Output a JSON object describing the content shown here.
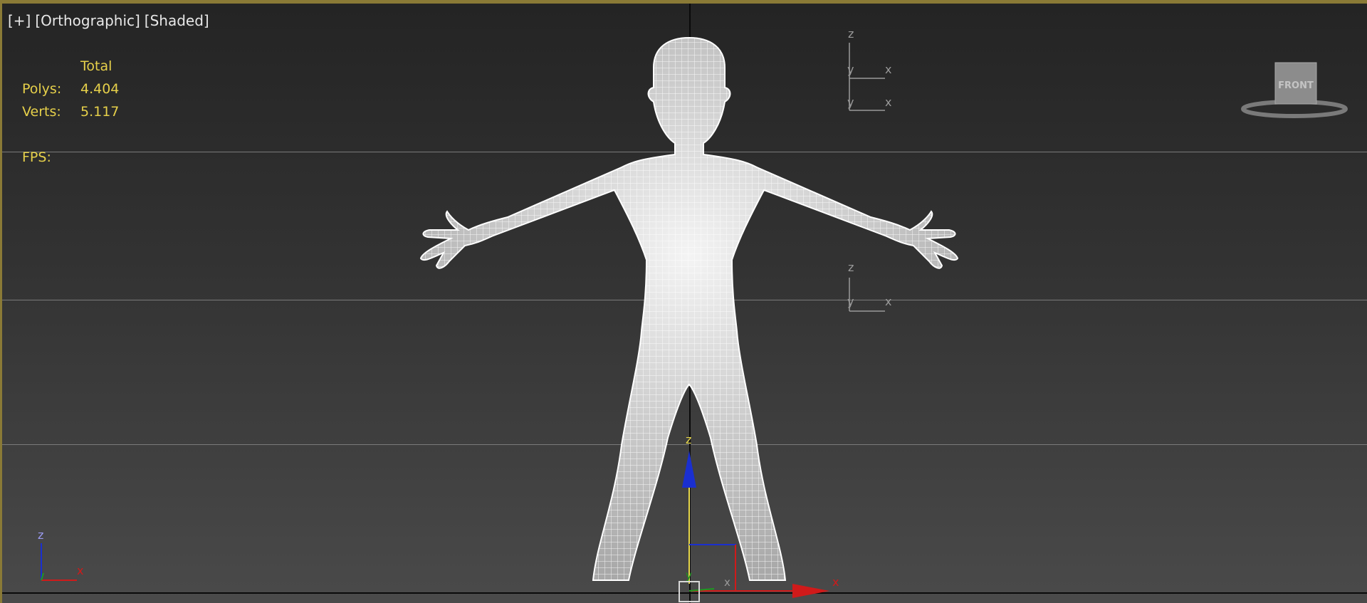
{
  "viewport": {
    "labels": [
      "[+]",
      "[Orthographic]",
      "[Shaded]"
    ],
    "view_mode": "Orthographic",
    "shading": "Shaded"
  },
  "stats": {
    "header": "Total",
    "polys_label": "Polys:",
    "polys_value": "4.404",
    "verts_label": "Verts:",
    "verts_value": "5.117",
    "fps_label": "FPS:"
  },
  "viewcube": {
    "face_label": "FRONT"
  },
  "axes": {
    "x": "x",
    "y": "y",
    "z": "z"
  },
  "colors": {
    "stats_text": "#e6d04a",
    "x_axis": "#d01a1a",
    "y_axis": "#1f9a1f",
    "z_axis": "#1a2fd0",
    "gizmo_z_label": "#e8d84a",
    "border_active": "#8a7a36"
  }
}
